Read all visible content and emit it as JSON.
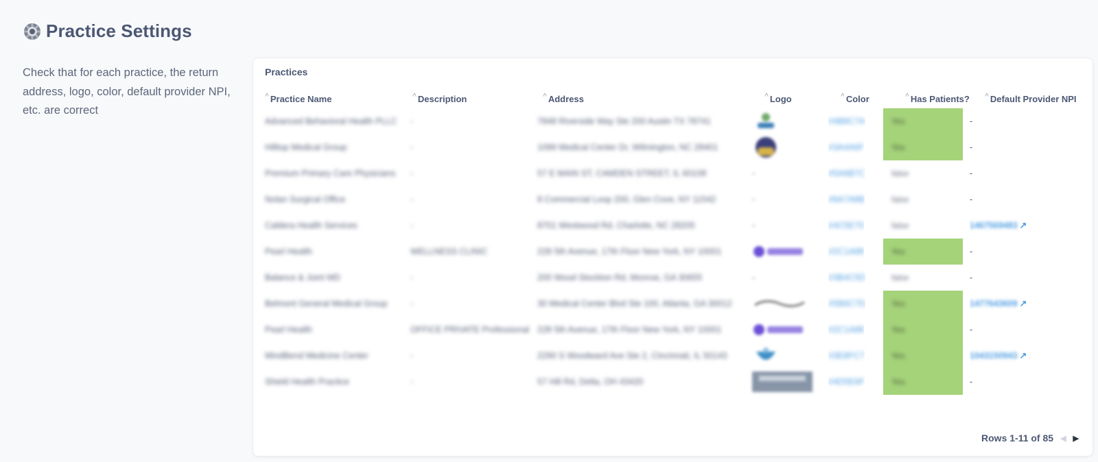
{
  "page": {
    "title": "Practice Settings",
    "description": "Check that for each practice, the return address, logo, color, default provider NPI, etc. are correct"
  },
  "card": {
    "title": "Practices",
    "columns": [
      "Practice Name",
      "Description",
      "Address",
      "Logo",
      "Color",
      "Has Patients?",
      "Default Provider NPI"
    ],
    "rows": [
      {
        "name": "Advanced Behavioral Health PLLC",
        "description": "-",
        "address": "7848 Riverside Way Ste 200 Austin TX 78741",
        "logo": "tree",
        "color": "#4B8C7A",
        "has_patients": "Yes",
        "npi": "-"
      },
      {
        "name": "Hilltop Medical Group",
        "description": "-",
        "address": "1099 Medical Center Dr, Wilmington, NC 28401",
        "logo": "crest",
        "color": "#3A4A6F",
        "has_patients": "Yes",
        "npi": "-"
      },
      {
        "name": "Premium Primary Care Physicians",
        "description": "-",
        "address": "57 E MAIN ST, CAMDEN STREET, IL 60108",
        "logo": "-",
        "color": "#5A6B7C",
        "has_patients": "false",
        "npi": "-"
      },
      {
        "name": "Nolan Surgical Office",
        "description": "-",
        "address": "8 Commercial Loop 200, Glen Cove, NY 11542",
        "logo": "-",
        "color": "#6A7A8B",
        "has_patients": "false",
        "npi": "-"
      },
      {
        "name": "Caldera Health Services",
        "description": "-",
        "address": "8701 Westwood Rd, Charlotte, NC 28205",
        "logo": "-",
        "color": "#4C5E70",
        "has_patients": "false",
        "npi": "1467569483"
      },
      {
        "name": "Pearl Health",
        "description": "WELLNESS CLINIC",
        "address": "228 5th Avenue, 17th Floor New York, NY 10001",
        "logo": "pearl",
        "color": "#2C1A88",
        "has_patients": "Yes",
        "npi": "-"
      },
      {
        "name": "Balance & Joint MD",
        "description": "-",
        "address": "200 Wood Stockton Rd, Monroe, GA 30655",
        "logo": "-",
        "color": "#3B4C5D",
        "has_patients": "false",
        "npi": "-"
      },
      {
        "name": "Belmont General Medical Group",
        "description": "-",
        "address": "30 Medical Center Blvd Ste 100, Atlanta, GA 30012",
        "logo": "script",
        "color": "#5B6C7D",
        "has_patients": "Yes",
        "npi": "1477643609"
      },
      {
        "name": "Pearl Health",
        "description": "OFFICE PRIVATE Professional",
        "address": "228 5th Avenue, 17th Floor New York, NY 10001",
        "logo": "pearl",
        "color": "#2C1A88",
        "has_patients": "Yes",
        "npi": "-"
      },
      {
        "name": "MindBend Medicine Center",
        "description": "-",
        "address": "2290 S Woodward Ave Ste 2, Cincinnati, IL 50143",
        "logo": "bowl",
        "color": "#3E8FC7",
        "has_patients": "Yes",
        "npi": "1043150943"
      },
      {
        "name": "Shield Health Practice",
        "description": "-",
        "address": "57 Hill Rd, Delta, OH 43420",
        "logo": "photo",
        "color": "#4D5E6F",
        "has_patients": "Yes",
        "npi": "-"
      }
    ],
    "footer": "Rows 1-11 of 85"
  },
  "icons": {
    "header": "gear-icon",
    "sort": "caret-up-icon",
    "prev": "arrow-left-icon",
    "next": "arrow-right-icon",
    "npi": "external-link-icon"
  },
  "colors": {
    "accent": "#509EE3",
    "yes_fill": "#A5D37A",
    "text": "#4C5773"
  }
}
